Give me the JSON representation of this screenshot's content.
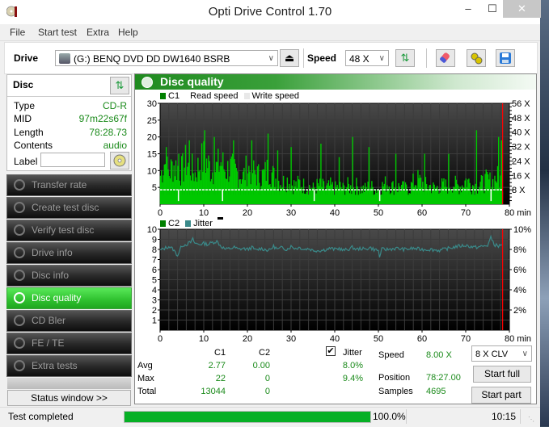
{
  "window": {
    "title": "Opti Drive Control 1.70",
    "controls": {
      "minimize": "–",
      "maximize": "☐",
      "close": "✕"
    }
  },
  "menu": [
    "File",
    "Start test",
    "Extra",
    "Help"
  ],
  "toolbar": {
    "drive_label": "Drive",
    "drive_value": "(G:)  BENQ DVD DD DW1640 BSRB",
    "speed_label": "Speed",
    "speed_value": "48 X",
    "icons": [
      "eject-icon",
      "refresh-icon",
      "erase-icon",
      "settings-icon",
      "save-icon"
    ]
  },
  "disc": {
    "header": "Disc",
    "rows": [
      {
        "label": "Type",
        "value": "CD-R"
      },
      {
        "label": "MID",
        "value": "97m22s67f"
      },
      {
        "label": "Length",
        "value": "78:28.73"
      },
      {
        "label": "Contents",
        "value": "audio"
      }
    ],
    "label_field": {
      "label": "Label",
      "value": ""
    }
  },
  "nav": [
    {
      "label": "Transfer rate",
      "active": false
    },
    {
      "label": "Create test disc",
      "active": false
    },
    {
      "label": "Verify test disc",
      "active": false
    },
    {
      "label": "Drive info",
      "active": false
    },
    {
      "label": "Disc info",
      "active": false
    },
    {
      "label": "Disc quality",
      "active": true
    },
    {
      "label": "CD Bler",
      "active": false
    },
    {
      "label": "FE / TE",
      "active": false
    },
    {
      "label": "Extra tests",
      "active": false
    }
  ],
  "status_window_button": "Status window >>",
  "panel": {
    "title": "Disc quality"
  },
  "chart_data": [
    {
      "type": "bar",
      "title": "C1",
      "legend": [
        "C1",
        "Read speed",
        "Write speed"
      ],
      "colors": {
        "c1": "#00c800",
        "read_speed": "#ffffff",
        "position_marker": "#ff0000"
      },
      "xlabel": "min",
      "x_ticks": [
        0,
        10,
        20,
        30,
        40,
        50,
        60,
        70,
        80
      ],
      "x_tick_labels": [
        "0",
        "10",
        "20",
        "30",
        "40",
        "50",
        "60",
        "70",
        "80 min"
      ],
      "xlim": [
        0,
        80
      ],
      "ylim": [
        0,
        30
      ],
      "y_ticks": [
        5,
        10,
        15,
        20,
        25,
        30
      ],
      "y2_ticks": [
        "8 X",
        "16 X",
        "24 X",
        "32 X",
        "40 X",
        "48 X",
        "56 X"
      ],
      "y2lim": [
        0,
        56
      ],
      "read_speed_x": 8.0,
      "current_position_min": 78.45,
      "c1_profile": [
        [
          0,
          9
        ],
        [
          1,
          14
        ],
        [
          2,
          10
        ],
        [
          3,
          13
        ],
        [
          4,
          12
        ],
        [
          5,
          11
        ],
        [
          6,
          14
        ],
        [
          7,
          12
        ],
        [
          8,
          10
        ],
        [
          9,
          13
        ],
        [
          10,
          15
        ],
        [
          11,
          13
        ],
        [
          12,
          11
        ],
        [
          13,
          12
        ],
        [
          14,
          14
        ],
        [
          15,
          11
        ],
        [
          16,
          12
        ],
        [
          17,
          11
        ],
        [
          18,
          10
        ],
        [
          19,
          9
        ],
        [
          20,
          12
        ],
        [
          21,
          11
        ],
        [
          22,
          10
        ],
        [
          23,
          9
        ],
        [
          24,
          10
        ],
        [
          25,
          12
        ],
        [
          26,
          9
        ],
        [
          27,
          8
        ],
        [
          28,
          7
        ],
        [
          29,
          8
        ],
        [
          30,
          7
        ],
        [
          31,
          6
        ],
        [
          32,
          7
        ],
        [
          33,
          6
        ],
        [
          34,
          6
        ],
        [
          35,
          5
        ],
        [
          36,
          6
        ],
        [
          37,
          6
        ],
        [
          38,
          5
        ],
        [
          39,
          6
        ],
        [
          40,
          5
        ],
        [
          41,
          6
        ],
        [
          42,
          5
        ],
        [
          43,
          6
        ],
        [
          44,
          5
        ],
        [
          45,
          6
        ],
        [
          46,
          5
        ],
        [
          47,
          5
        ],
        [
          48,
          6
        ],
        [
          49,
          5
        ],
        [
          50,
          5
        ],
        [
          51,
          6
        ],
        [
          52,
          7
        ],
        [
          53,
          6
        ],
        [
          54,
          5
        ],
        [
          55,
          6
        ],
        [
          56,
          5
        ],
        [
          57,
          5
        ],
        [
          58,
          7
        ],
        [
          59,
          8
        ],
        [
          60,
          7
        ],
        [
          61,
          6
        ],
        [
          62,
          6
        ],
        [
          63,
          5
        ],
        [
          64,
          6
        ],
        [
          65,
          6
        ],
        [
          66,
          6
        ],
        [
          67,
          7
        ],
        [
          68,
          6
        ],
        [
          69,
          6
        ],
        [
          70,
          8
        ],
        [
          71,
          7
        ],
        [
          72,
          6
        ],
        [
          73,
          6
        ],
        [
          74,
          7
        ],
        [
          75,
          8
        ],
        [
          76,
          7
        ],
        [
          77,
          9
        ],
        [
          78,
          8
        ],
        [
          78.45,
          8
        ]
      ],
      "c1_peaks": [
        [
          1.5,
          17
        ],
        [
          4.2,
          15
        ],
        [
          6.8,
          19
        ],
        [
          10.2,
          22
        ],
        [
          12.5,
          20
        ],
        [
          16.8,
          19
        ],
        [
          21,
          19
        ],
        [
          24.8,
          21
        ],
        [
          27,
          16
        ],
        [
          30,
          17
        ],
        [
          36.8,
          18
        ],
        [
          41,
          14
        ],
        [
          44,
          20
        ],
        [
          47.8,
          17
        ],
        [
          54,
          15
        ],
        [
          60.5,
          15
        ],
        [
          66,
          15
        ],
        [
          72.5,
          22
        ],
        [
          77.5,
          20
        ],
        [
          78.2,
          19
        ]
      ]
    },
    {
      "type": "line",
      "title": "C2 / Jitter",
      "legend": [
        "C2",
        "Jitter"
      ],
      "colors": {
        "c2": "#008000",
        "jitter": "#3a8a8a",
        "position_marker": "#ff0000"
      },
      "xlabel": "min",
      "x_ticks": [
        0,
        10,
        20,
        30,
        40,
        50,
        60,
        70,
        80
      ],
      "x_tick_labels": [
        "0",
        "10",
        "20",
        "30",
        "40",
        "50",
        "60",
        "70",
        "80 min"
      ],
      "xlim": [
        0,
        80
      ],
      "ylim": [
        0,
        10
      ],
      "y_ticks": [
        1,
        2,
        3,
        4,
        5,
        6,
        7,
        8,
        9,
        10
      ],
      "y2_ticks": [
        "2%",
        "4%",
        "6%",
        "8%",
        "10%"
      ],
      "y2lim": [
        0,
        10
      ],
      "c2_values_all": 0,
      "jitter_profile": [
        [
          0,
          7.9
        ],
        [
          1,
          8.1
        ],
        [
          2,
          8.3
        ],
        [
          3,
          8.0
        ],
        [
          4,
          7.4
        ],
        [
          5,
          8.4
        ],
        [
          6,
          8.5
        ],
        [
          7,
          8.7
        ],
        [
          7.5,
          9.0
        ],
        [
          8,
          8.6
        ],
        [
          9,
          8.5
        ],
        [
          10,
          8.6
        ],
        [
          11,
          8.5
        ],
        [
          12,
          8.7
        ],
        [
          13,
          8.8
        ],
        [
          14,
          8.3
        ],
        [
          15,
          8.0
        ],
        [
          16,
          8.1
        ],
        [
          17,
          8.2
        ],
        [
          18,
          8.0
        ],
        [
          19,
          8.1
        ],
        [
          20,
          8.0
        ],
        [
          21,
          8.2
        ],
        [
          22,
          7.9
        ],
        [
          23,
          8.1
        ],
        [
          24,
          8.0
        ],
        [
          25,
          7.9
        ],
        [
          26,
          8.3
        ],
        [
          27,
          8.0
        ],
        [
          28,
          8.2
        ],
        [
          29,
          8.0
        ],
        [
          30,
          8.3
        ],
        [
          31,
          8.1
        ],
        [
          32,
          8.2
        ],
        [
          33,
          8.0
        ],
        [
          34,
          8.1
        ],
        [
          35,
          7.9
        ],
        [
          36,
          7.9
        ],
        [
          37,
          7.9
        ],
        [
          38,
          8.0
        ],
        [
          39,
          8.1
        ],
        [
          40,
          8.0
        ],
        [
          41,
          8.1
        ],
        [
          42,
          7.9
        ],
        [
          43,
          8.0
        ],
        [
          44,
          8.2
        ],
        [
          45,
          8.0
        ],
        [
          46,
          8.1
        ],
        [
          47,
          8.0
        ],
        [
          48,
          8.2
        ],
        [
          49,
          8.0
        ],
        [
          50,
          7.9
        ],
        [
          50.3,
          7.0
        ],
        [
          50.6,
          8.0
        ],
        [
          52,
          8.0
        ],
        [
          54,
          8.1
        ],
        [
          56,
          8.0
        ],
        [
          58,
          8.1
        ],
        [
          60,
          8.0
        ],
        [
          62,
          8.0
        ],
        [
          64,
          7.9
        ],
        [
          66,
          8.1
        ],
        [
          68,
          8.3
        ],
        [
          70,
          8.4
        ],
        [
          72,
          8.2
        ],
        [
          74,
          8.3
        ],
        [
          75,
          8.4
        ],
        [
          75.8,
          9.2
        ],
        [
          76.5,
          8.5
        ],
        [
          77.5,
          8.3
        ],
        [
          78.45,
          8.6
        ]
      ]
    }
  ],
  "stats": {
    "columns": [
      "C1",
      "C2"
    ],
    "rows": [
      {
        "label": "Avg",
        "c1": "2.77",
        "c2": "0.00",
        "jitter": "8.0%"
      },
      {
        "label": "Max",
        "c1": "22",
        "c2": "0",
        "jitter": "9.4%"
      },
      {
        "label": "Total",
        "c1": "13044",
        "c2": "0",
        "jitter": ""
      }
    ],
    "jitter_checkbox": {
      "label": "Jitter",
      "checked": true
    },
    "speed_label": "Speed",
    "speed_value": "8.00 X",
    "position_label": "Position",
    "position_value": "78:27.00",
    "samples_label": "Samples",
    "samples_value": "4695",
    "speed_mode": "8 X CLV",
    "start_full": "Start full",
    "start_part": "Start part"
  },
  "statusbar": {
    "message": "Test completed",
    "progress_percent": 100.0,
    "progress_text": "100.0%",
    "time": "10:15"
  }
}
